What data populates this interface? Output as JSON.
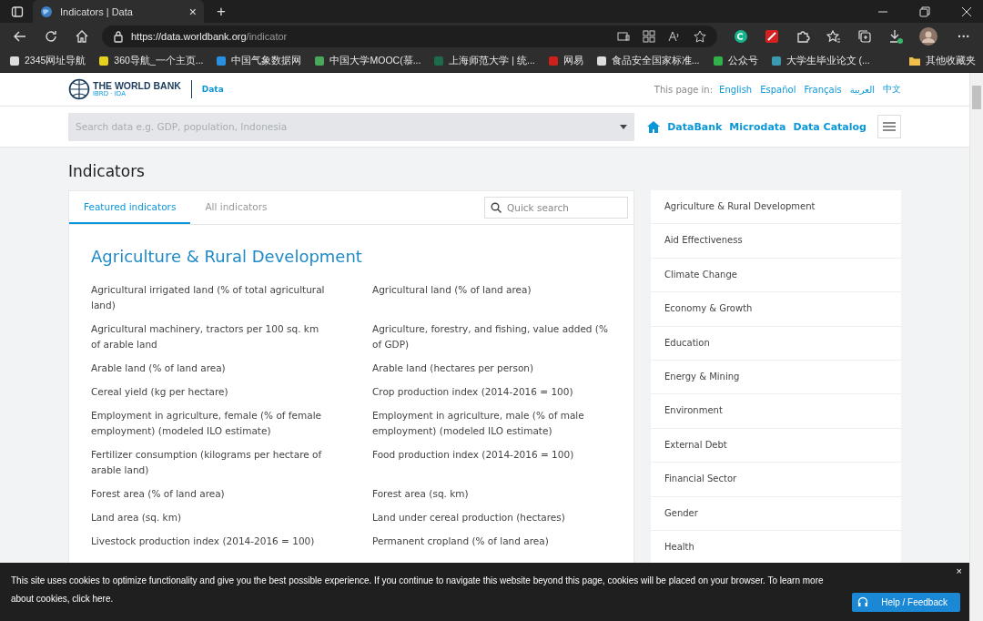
{
  "browser": {
    "tab_title": "Indicators | Data",
    "tab_close": "×",
    "new_tab": "+",
    "url_host": "https://data.worldbank.org",
    "url_path": "/indicator",
    "bookmarks": [
      {
        "label": "2345网址导航",
        "color": "#dddddd"
      },
      {
        "label": "360导航_一个主页...",
        "color": "#e6d21e"
      },
      {
        "label": "中国气象数据网",
        "color": "#2a8fe0"
      },
      {
        "label": "中国大学MOOC(慕...",
        "color": "#4aa85a"
      },
      {
        "label": "上海师范大学 | 统...",
        "color": "#1d6b4a"
      },
      {
        "label": "网易",
        "color": "#d0201c"
      },
      {
        "label": "食品安全国家标准...",
        "color": "#dddddd"
      },
      {
        "label": "公众号",
        "color": "#32b04a"
      },
      {
        "label": "大学生毕业论文 (...",
        "color": "#3a9ab0"
      }
    ],
    "other_bookmarks": "其他收藏夹",
    "more": "···"
  },
  "header": {
    "logo_text": "THE WORLD BANK",
    "logo_sub": "IBRD · IDA",
    "section": "Data",
    "page_in": "This page in:",
    "languages": [
      "English",
      "Español",
      "Français",
      "العربية",
      "中文"
    ]
  },
  "search": {
    "placeholder": "Search data e.g. GDP, population, Indonesia"
  },
  "nav": [
    "DataBank",
    "Microdata",
    "Data Catalog"
  ],
  "page_title": "Indicators",
  "tabs": [
    {
      "label": "Featured indicators",
      "selected": true
    },
    {
      "label": "All indicators",
      "selected": false
    }
  ],
  "quick_search": {
    "placeholder": "Quick search"
  },
  "section_title": "Agriculture & Rural Development",
  "indicators": [
    [
      "Agricultural irrigated land (% of total agricultural land)",
      "Agricultural land (% of land area)"
    ],
    [
      "Agricultural machinery, tractors per 100 sq. km of arable land",
      "Agriculture, forestry, and fishing, value added (% of GDP)"
    ],
    [
      "Arable land (% of land area)",
      "Arable land (hectares per person)"
    ],
    [
      "Cereal yield (kg per hectare)",
      "Crop production index (2014-2016 = 100)"
    ],
    [
      "Employment in agriculture, female (% of female employment) (modeled ILO estimate)",
      "Employment in agriculture, male (% of male employment) (modeled ILO estimate)"
    ],
    [
      "Fertilizer consumption (kilograms per hectare of arable land)",
      "Food production index (2014-2016 = 100)"
    ],
    [
      "Forest area (% of land area)",
      "Forest area (sq. km)"
    ],
    [
      "Land area (sq. km)",
      "Land under cereal production (hectares)"
    ],
    [
      "Livestock production index (2014-2016 = 100)",
      "Permanent cropland (% of land area)"
    ]
  ],
  "topics": [
    "Agriculture & Rural Development",
    "Aid Effectiveness",
    "Climate Change",
    "Economy & Growth",
    "Education",
    "Energy & Mining",
    "Environment",
    "External Debt",
    "Financial Sector",
    "Gender",
    "Health"
  ],
  "cookie_banner": {
    "text": "This site uses cookies to optimize functionality and give you the best possible experience. If you continue to navigate this website beyond this page, cookies will be placed on your browser. To learn more about cookies,",
    "link": "click here.",
    "close": "×"
  },
  "help_button": "Help / Feedback"
}
